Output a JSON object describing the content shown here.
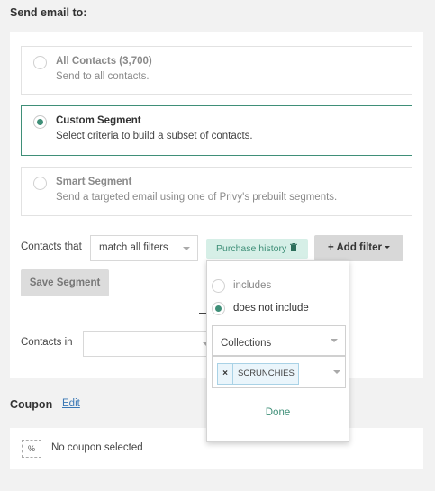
{
  "send_to": {
    "title": "Send email to:",
    "options": [
      {
        "title": "All Contacts (3,700)",
        "description": "Send to all contacts.",
        "selected": false
      },
      {
        "title": "Custom Segment",
        "description": "Select criteria to build a subset of contacts.",
        "selected": true
      },
      {
        "title": "Smart Segment",
        "description": "Send a targeted email using one of Privy's prebuilt segments.",
        "selected": false
      }
    ]
  },
  "segment": {
    "contacts_that_label": "Contacts that",
    "match_select_value": "match all filters",
    "filter_chip_label": "Purchase history",
    "add_filter_label": "+ Add filter",
    "save_segment_label": "Save Segment",
    "contacts_in_label": "Contacts in",
    "contacts_in_value": ""
  },
  "popover": {
    "options": [
      {
        "label": "includes",
        "selected": false
      },
      {
        "label": "does not include",
        "selected": true
      }
    ],
    "collection_select_value": "Collections",
    "selected_tag": "SCRUNCHIES",
    "tag_remove_glyph": "×",
    "done_label": "Done"
  },
  "coupon": {
    "title": "Coupon",
    "edit_label": "Edit",
    "icon_glyph": "%",
    "status": "No coupon selected"
  },
  "colors": {
    "accent": "#3f8f78",
    "chip_bg": "#d6efe7",
    "link": "#3a78b5"
  },
  "icons": [
    "radio-button-icon",
    "trash-icon",
    "caret-down-icon",
    "coupon-icon",
    "remove-tag-icon"
  ]
}
